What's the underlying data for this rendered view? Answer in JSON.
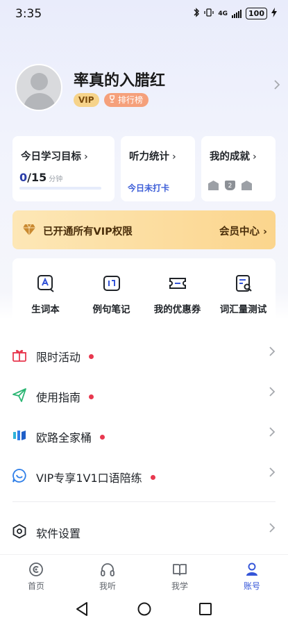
{
  "status_bar": {
    "time": "3:35",
    "network": "4G",
    "battery": "100"
  },
  "profile": {
    "name": "率真的入腊红",
    "vip_badge": "VIP",
    "rank_badge": "排行榜"
  },
  "cards": {
    "goal": {
      "title": "今日学习目标",
      "current": "0",
      "total": "/15",
      "unit": "分钟",
      "progress": 0.0
    },
    "listening": {
      "title": "听力统计",
      "status": "今日未打卡"
    },
    "achievements": {
      "title": "我的成就",
      "mid_level": "2"
    }
  },
  "vip_banner": {
    "text": "已开通所有VIP权限",
    "link": "会员中心"
  },
  "tools": [
    {
      "label": "生词本",
      "icon": "vocabulary-book-icon"
    },
    {
      "label": "例句笔记",
      "icon": "sentence-notes-icon"
    },
    {
      "label": "我的优惠券",
      "icon": "coupon-icon"
    },
    {
      "label": "词汇量测试",
      "icon": "vocabulary-test-icon"
    }
  ],
  "menu": [
    {
      "label": "限时活动",
      "icon": "gift-icon",
      "color": "#e8384f"
    },
    {
      "label": "使用指南",
      "icon": "paper-plane-icon",
      "color": "#2bb673"
    },
    {
      "label": "欧路全家桶",
      "icon": "eudic-suite-icon",
      "color": "#2f7fe8"
    },
    {
      "label": "VIP专享1V1口语陪练",
      "icon": "chat-bubble-icon",
      "color": "#2f7fe8"
    }
  ],
  "settings": {
    "label": "软件设置",
    "icon": "hexagon-settings-icon"
  },
  "tabs": [
    {
      "label": "首页",
      "icon": "home-icon",
      "active": false
    },
    {
      "label": "我听",
      "icon": "headphones-icon",
      "active": false
    },
    {
      "label": "我学",
      "icon": "book-icon",
      "active": false
    },
    {
      "label": "账号",
      "icon": "user-icon",
      "active": true
    }
  ],
  "colors": {
    "accent": "#3455d8",
    "notice_dot": "#e8384f",
    "vip_gold": "#fbd58d",
    "rank_orange": "#f5a07b"
  }
}
